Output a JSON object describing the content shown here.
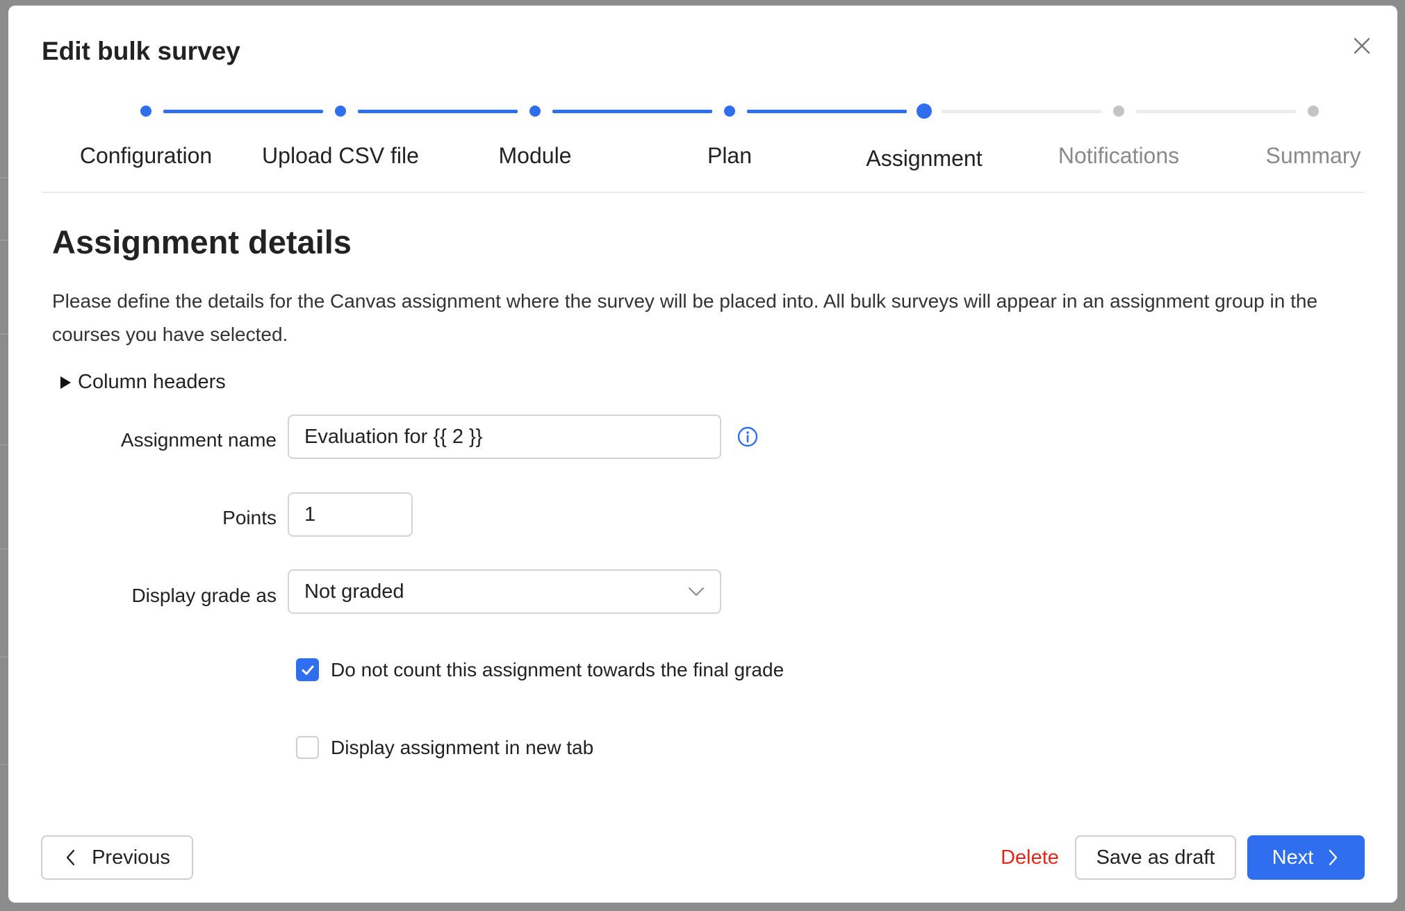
{
  "modal": {
    "title": "Edit bulk survey"
  },
  "steps": [
    {
      "label": "Configuration",
      "state": "done"
    },
    {
      "label": "Upload CSV file",
      "state": "done"
    },
    {
      "label": "Module",
      "state": "done"
    },
    {
      "label": "Plan",
      "state": "done"
    },
    {
      "label": "Assignment",
      "state": "current"
    },
    {
      "label": "Notifications",
      "state": "pending"
    },
    {
      "label": "Summary",
      "state": "pending"
    }
  ],
  "section": {
    "title": "Assignment details",
    "description": "Please define the details for the Canvas assignment where the survey will be placed into. All bulk surveys will appear in an assignment group in the courses you have selected."
  },
  "column_headers": {
    "label": "Column headers"
  },
  "form": {
    "assignment_name": {
      "label": "Assignment name",
      "value": "Evaluation for {{ 2 }}"
    },
    "points": {
      "label": "Points",
      "value": "1"
    },
    "display_grade": {
      "label": "Display grade as",
      "value": "Not graded"
    },
    "no_count": {
      "label": "Do not count this assignment towards the final grade",
      "checked": true
    },
    "new_tab": {
      "label": "Display assignment in new tab",
      "checked": false
    }
  },
  "footer": {
    "previous_label": "Previous",
    "delete_label": "Delete",
    "save_draft_label": "Save as draft",
    "next_label": "Next"
  },
  "colors": {
    "accent": "#2f6fef",
    "danger": "#e5261b",
    "pending": "#c4c4c4",
    "pending_text": "#8a8a8a"
  },
  "icons": {
    "close": "close-icon",
    "info": "info-icon",
    "dropdown": "chevron-down-icon",
    "previous": "chevron-left-icon",
    "next": "chevron-right-icon",
    "check": "check-icon",
    "disclosure": "triangle-right-icon"
  }
}
